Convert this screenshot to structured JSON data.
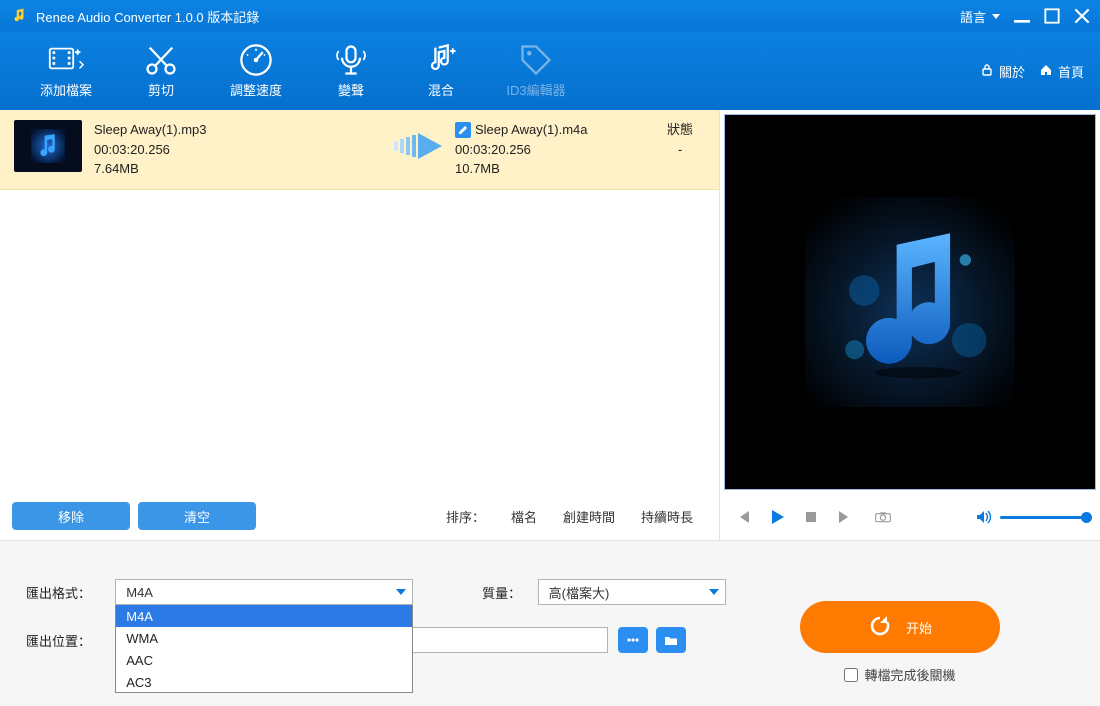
{
  "titlebar": {
    "title": "Renee Audio Converter 1.0.0 版本記錄",
    "lang": "語言"
  },
  "toolbar": {
    "add": "添加檔案",
    "cut": "剪切",
    "speed": "調整速度",
    "voice": "變聲",
    "mix": "混合",
    "id3": "ID3編輯器",
    "about": "關於",
    "home": "首頁"
  },
  "file": {
    "in_name": "Sleep Away(1).mp3",
    "in_dur": "00:03:20.256",
    "in_size": "7.64MB",
    "out_name": "Sleep Away(1).m4a",
    "out_dur": "00:03:20.256",
    "out_size": "10.7MB",
    "status_hdr": "狀態",
    "status_val": "-"
  },
  "listfoot": {
    "remove": "移除",
    "clear": "清空",
    "sort": "排序：",
    "name": "檔名",
    "created": "創建時間",
    "duration": "持續時長"
  },
  "form": {
    "format_label": "匯出格式：",
    "format_value": "M4A",
    "quality_label": "質量：",
    "quality_value": "高(檔案大)",
    "location_label": "匯出位置：",
    "options": [
      "M4A",
      "WMA",
      "AAC",
      "AC3"
    ]
  },
  "start": {
    "label": "开始",
    "shutdown": "轉檔完成後關機"
  }
}
